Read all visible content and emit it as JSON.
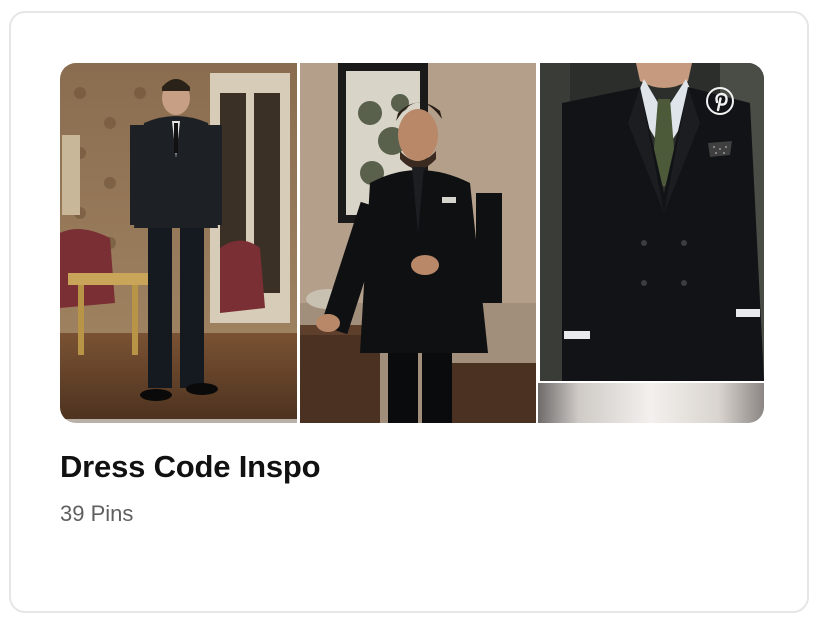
{
  "board": {
    "title": "Dress Code Inspo",
    "pin_count": "39 Pins"
  },
  "collage": {
    "tiles": [
      {
        "subject": "man in dark double-breasted suit in ornate room",
        "icon": "photo"
      },
      {
        "subject": "man in black tuxedo leaning on table",
        "icon": "photo"
      },
      {
        "subject": "close-up of black double-breasted suit with green tie",
        "icon": "photo"
      },
      {
        "subject": "partial pin preview",
        "icon": "photo"
      }
    ],
    "badge_icon": "pinterest-logo-icon"
  },
  "colors": {
    "title": "#111111",
    "subtitle": "#5f5f5f",
    "card_border": "#e6e6e6"
  }
}
